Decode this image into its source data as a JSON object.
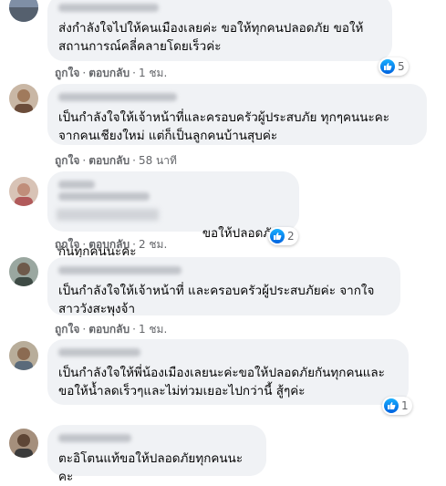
{
  "comments": [
    {
      "text": "ส่งกำลังใจไปให้คนเมืองเลยค่ะ ขอให้ทุกคนปลอดภัย ขอให้\nสถานการณ์คลี่คลายโดยเร็วค่ะ",
      "like": "ถูกใจ",
      "reply": "ตอบกลับ",
      "time": "1 ชม.",
      "reactions": "5"
    },
    {
      "text": "เป็นกำลังใจให้เจ้าหน้าที่และครอบครัวผู้ประสบภัย ทุกๆคนนะคะ\nจากคนเชียงใหม่ แต่ก็เป็นลูกคนบ้านสุบค่ะ",
      "like": "ถูกใจ",
      "reply": "ตอบกลับ",
      "time": "58 นาที",
      "reactions": ""
    },
    {
      "text": "ขอให้ปลอดภัยกันทุกคนนะคะ",
      "like": "ถูกใจ",
      "reply": "ตอบกลับ",
      "time": "2 ชม.",
      "reactions": "2"
    },
    {
      "text": "เป็นกำลังใจให้เจ้าหน้าที่ และครอบครัวผู้ประสบภัยค่ะ จากใจ\nสาววังสะพุงจ้า",
      "like": "ถูกใจ",
      "reply": "ตอบกลับ",
      "time": "1 ชม.",
      "reactions": ""
    },
    {
      "text": "เป็นกำลังใจให้พี่น้องเมืองเลยนะค่ะขอให้ปลอดภัยกันทุกคนและ\nขอให้น้ำลดเร็วๆและไม่ท่วมเยอะไปกว่านี้ สู้ๆค่ะ",
      "like": "ถูกใจ",
      "reply": "ตอบกลับ",
      "time": "1 ชม.",
      "reactions": "1"
    },
    {
      "text": "ตะอิโตนแท้ขอให้ปลอดภัยทุกคนนะคะ",
      "like": "",
      "reply": "",
      "time": "",
      "reactions": ""
    }
  ],
  "colors": {
    "bubble": "#f0f2f5",
    "meta_text": "#65676b",
    "like_blue": "#0866ff"
  },
  "icons": {
    "like": "like-icon"
  }
}
